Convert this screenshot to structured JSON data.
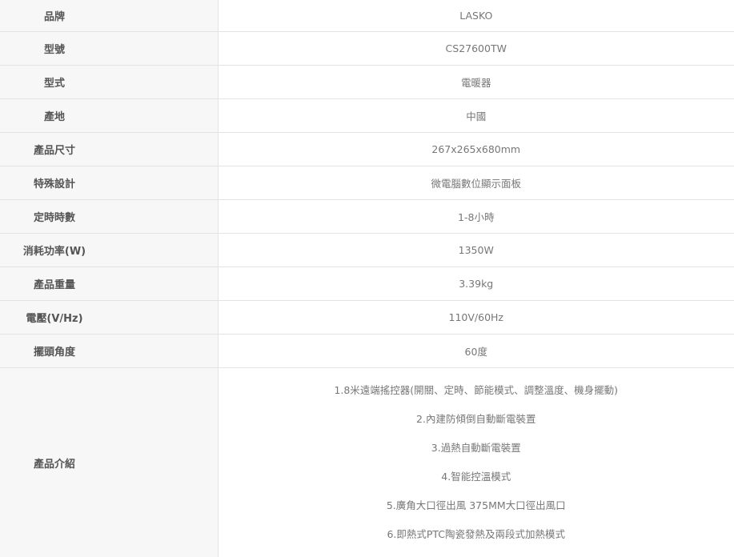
{
  "specs": [
    {
      "label": "品牌",
      "value": "LASKO"
    },
    {
      "label": "型號",
      "value": "CS27600TW"
    },
    {
      "label": "型式",
      "value": "電暖器"
    },
    {
      "label": "產地",
      "value": "中國"
    },
    {
      "label": "產品尺寸",
      "value": "267x265x680mm"
    },
    {
      "label": "特殊設計",
      "value": "微電腦數位顯示面板"
    },
    {
      "label": "定時時數",
      "value": "1-8小時"
    },
    {
      "label": "消耗功率(W)",
      "value": "1350W"
    },
    {
      "label": "產品重量",
      "value": "3.39kg"
    },
    {
      "label": "電壓(V/Hz)",
      "value": "110V/60Hz"
    },
    {
      "label": "擺頭角度",
      "value": "60度"
    }
  ],
  "intro": {
    "label": "產品介紹",
    "items": [
      "1.8米遠端搖控器(開關、定時、節能模式、調整溫度、機身擺動)",
      "2.內建防傾倒自動斷電裝置",
      "3.過熱自動斷電裝置",
      "4.智能控溫模式",
      "5.廣角大口徑出風 375MM大口徑出風口",
      "6.即熱式PTC陶瓷發熱及兩段式加熱模式"
    ]
  }
}
